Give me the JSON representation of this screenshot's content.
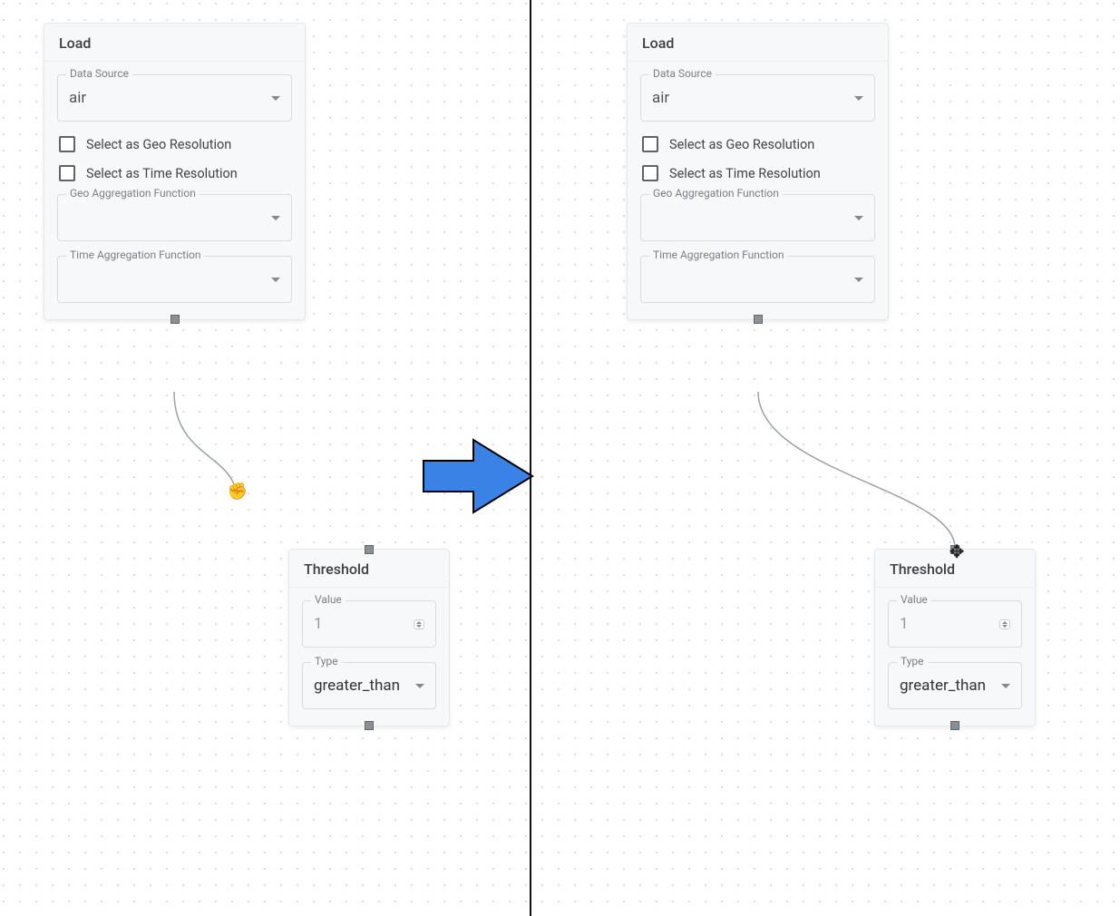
{
  "left": {
    "load": {
      "title": "Load",
      "dataSource": {
        "label": "Data Source",
        "value": "air"
      },
      "geoResolution": {
        "label": "Select as Geo Resolution",
        "checked": false
      },
      "timeResolution": {
        "label": "Select as Time Resolution",
        "checked": false
      },
      "geoAgg": {
        "label": "Geo Aggregation Function",
        "value": ""
      },
      "timeAgg": {
        "label": "Time Aggregation Function",
        "value": ""
      }
    },
    "threshold": {
      "title": "Threshold",
      "value": {
        "label": "Value",
        "value": "1"
      },
      "type": {
        "label": "Type",
        "value": "greater_than"
      }
    }
  },
  "right": {
    "load": {
      "title": "Load",
      "dataSource": {
        "label": "Data Source",
        "value": "air"
      },
      "geoResolution": {
        "label": "Select as Geo Resolution",
        "checked": false
      },
      "timeResolution": {
        "label": "Select as Time Resolution",
        "checked": false
      },
      "geoAgg": {
        "label": "Geo Aggregation Function",
        "value": ""
      },
      "timeAgg": {
        "label": "Time Aggregation Function",
        "value": ""
      }
    },
    "threshold": {
      "title": "Threshold",
      "value": {
        "label": "Value",
        "value": "1"
      },
      "type": {
        "label": "Type",
        "value": "greater_than"
      }
    }
  }
}
